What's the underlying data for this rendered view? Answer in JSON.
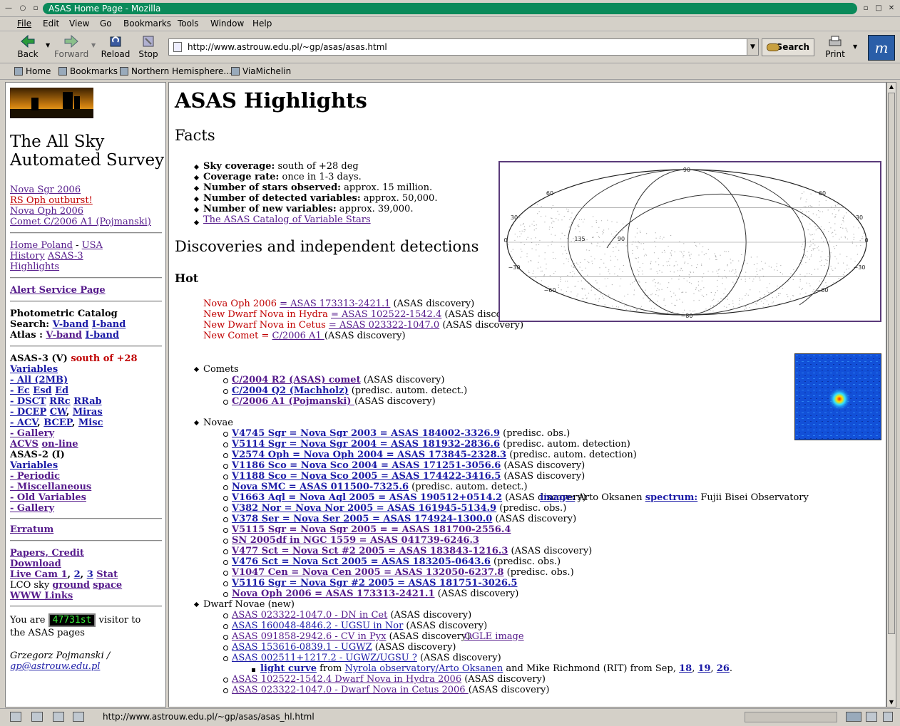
{
  "window": {
    "title": "ASAS Home Page - Mozilla"
  },
  "menu": [
    "File",
    "Edit",
    "View",
    "Go",
    "Bookmarks",
    "Tools",
    "Window",
    "Help"
  ],
  "nav": {
    "back": "Back",
    "forward": "Forward",
    "reload": "Reload",
    "stop": "Stop",
    "search": "Search",
    "print": "Print"
  },
  "url": "http://www.astrouw.edu.pl/~gp/asas/asas.html",
  "personal_bar": [
    "Home",
    "Bookmarks",
    "Northern Hemisphere...",
    "ViaMichelin"
  ],
  "status": "http://www.astrouw.edu.pl/~gp/asas/asas_hl.html",
  "sidebar": {
    "title1": "The All Sky",
    "title2": "Automated Survey",
    "news": [
      "Nova Sgr 2006",
      "RS Oph outburst!",
      "Nova Oph 2006",
      "Comet C/2006 A1 (Pojmanski)"
    ],
    "home_poland": "Home Poland",
    "dash": "-",
    "usa": "USA",
    "history": "History",
    "asas3": "ASAS-3",
    "highlights": "Highlights",
    "alert": "Alert Service Page",
    "photometric": "Photometric Catalog",
    "search_label": "Search:",
    "vband": "V-band",
    "iband": "I-band",
    "atlas_label": "Atlas :",
    "asas3v": "ASAS-3 (V)",
    "south": "south of +28",
    "variables": "Variables",
    "all": "- All (2MB)",
    "ec": "- Ec",
    "esd": "Esd",
    "ed": "Ed",
    "dscT": "- DSCT",
    "rrc": "RRc",
    "rrab": "RRab",
    "dcep": "- DCEP",
    "cw": "CW",
    "miras": "Miras",
    "acv": "- ACV",
    "bcep": "BCEP",
    "misc": "Misc",
    "gallery": "- Gallery",
    "acvs": "ACVS",
    "online": "on-line",
    "asas2": "ASAS-2 (I)",
    "variables2": "Variables",
    "periodic": "- Periodic",
    "miscellaneous": "- Miscellaneous",
    "old_variables": "- Old Variables",
    "gallery2": "- Gallery",
    "erratum": "Erratum",
    "papers": "Papers, Credit",
    "download": "Download",
    "livecam": "Live Cam 1",
    "cam2": "2",
    "cam3": "3",
    "stat": "Stat",
    "lco": "LCO sky",
    "ground": "ground",
    "space": "space",
    "www": "WWW Links",
    "you_are": "You are",
    "counter": "47731st",
    "visitor": "visitor to",
    "asas_pages": "the ASAS pages",
    "author": "Grzegorz Pojmanski /",
    "email": "gp@astrouw.edu.pl"
  },
  "content": {
    "h1": "ASAS Highlights",
    "facts": "Facts",
    "facts_items": [
      {
        "b": "Sky coverage:",
        "t": " south of +28 deg"
      },
      {
        "b": "Coverage rate:",
        "t": " once in 1-3 days."
      },
      {
        "b": "Number of stars observed:",
        "t": " approx. 15 million."
      },
      {
        "b": "Number of detected variables:",
        "t": " approx. 50,000."
      },
      {
        "b": "Number of new variables:",
        "t": " approx. 39,000."
      }
    ],
    "catalog_link": "The ASAS Catalog of Variable Stars",
    "discoveries": "Discoveries and independent detections",
    "hot": "Hot",
    "hot_items": [
      {
        "r": "Nova Oph 2006 ",
        "l": "= ASAS 173313-2421.1",
        "t": " (ASAS discovery)"
      },
      {
        "r": "New Dwarf Nova in Hydra ",
        "l": "= ASAS 102522-1542.4",
        "t": " (ASAS discovery)"
      },
      {
        "r": "New Dwarf Nova in Cetus ",
        "l": "= ASAS 023322-1047.0",
        "t": " (ASAS discovery)"
      },
      {
        "r": "New Comet = ",
        "l": "C/2006 A1 ",
        "t": "(ASAS discovery)"
      }
    ],
    "comets": "Comets",
    "comet_items": [
      {
        "l": "C/2004 R2 (ASAS) comet",
        "t": " (ASAS discovery)"
      },
      {
        "l": "C/2004 Q2 (Machholz)",
        "t": " (predisc. autom. detect.)"
      },
      {
        "l": "C/2006 A1 (Pojmanski) ",
        "t": "(ASAS discovery)"
      }
    ],
    "novae": "Novae",
    "nova_items": [
      {
        "l": "V4745 Sgr = Nova Sgr 2003 = ASAS 184002-3326.9",
        "t": " (predisc. obs.)"
      },
      {
        "l": "V5114 Sgr = Nova Sgr 2004 = ASAS 181932-2836.6",
        "t": " (predisc. autom. detection)"
      },
      {
        "l": "V2574 Oph = Nova Oph 2004 = ASAS 173845-2328.3",
        "t": " (predisc. autom. detection)"
      },
      {
        "l": "V1186 Sco = Nova Sco 2004 = ASAS 171251-3056.6",
        "t": " (ASAS discovery)"
      },
      {
        "l": "V1188 Sco = Nova Sco 2005 = ASAS 174422-3416.5",
        "t": " (ASAS discovery)"
      },
      {
        "l": "Nova SMC = ASAS 011500-7325.6",
        "t": " (predisc. autom. detect.)"
      },
      {
        "l": "V1663 Aql = Nova Aql 2005 = ASAS 190512+0514.2",
        "t": " (ASAS discovery)"
      },
      {
        "l": "V382 Nor = Nova Nor 2005 = ASAS 161945-5134.9",
        "t": " (predisc. obs.)"
      },
      {
        "l": "V378 Ser = Nova Ser 2005 = ASAS 174924-1300.0",
        "t": " (ASAS discovery)"
      },
      {
        "l": "V5115 Sgr = Nova Sgr 2005 = = ASAS 181700-2556.4",
        "t": ""
      },
      {
        "l": "SN 2005df in NGC 1559 = ASAS 041739-6246.3",
        "t": ""
      },
      {
        "l": "V477 Sct = Nova Sct #2 2005 = ASAS 183843-1216.3",
        "t": " (ASAS discovery)"
      },
      {
        "l": "V476 Sct = Nova Sct 2005 = ASAS 183205-0643.6",
        "t": " (predisc. obs.)"
      },
      {
        "l": "V1047 Cen = Nova Cen 2005 = ASAS 132050-6237.8",
        "t": " (predisc. obs.)"
      },
      {
        "l": "V5116 Sgr = Nova Sgr #2 2005 = ASAS 181751-3026.5",
        "t": ""
      },
      {
        "l": "Nova Oph 2006 = ASAS 173313-2421.1",
        "t": " (ASAS discovery)"
      }
    ],
    "aql_image": "image:",
    "aql_oksanen": " Arto Oksanen ",
    "aql_spectrum": "spectrum:",
    "aql_fujii": " Fujii Bisei Observatory",
    "dwarf": "Dwarf Novae (new)",
    "dwarf_items": [
      {
        "l": "ASAS 023322-1047.0 - DN in Cet",
        "t": " (ASAS discovery)"
      },
      {
        "l": "ASAS 160048-4846.2 - UGSU in Nor",
        "t": " (ASAS discovery)"
      },
      {
        "l": "ASAS 091858-2942.6 - CV in Pyx",
        "t": " (ASAS discovery). "
      },
      {
        "l": "ASAS 153616-0839.1 - UGWZ",
        "t": " (ASAS discovery)"
      },
      {
        "l": "ASAS 002511+1217.2 - UGWZ/UGSU ?",
        "t": " (ASAS discovery)"
      },
      {
        "l": "ASAS 102522-1542.4 Dwarf Nova in Hydra 2006",
        "t": " (ASAS discovery)"
      },
      {
        "l": "ASAS 023322-1047.0 - Dwarf Nova in Cetus 2006 ",
        "t": "(ASAS discovery)"
      }
    ],
    "ogle": "OGLE image",
    "lc_light": "light curve",
    "lc_from": " from ",
    "lc_nyrola": "Nyrola observatory/Arto Oksanen",
    "lc_mike": " and Mike Richmond (RIT) from Sep, ",
    "lc_18": "18",
    "lc_19": "19",
    "lc_26": "26",
    "comma": ", ",
    "period": ".",
    "map_labels": [
      "90",
      "60",
      "60",
      "30",
      "30",
      "0",
      "135",
      "90",
      "0",
      "−30",
      "−30",
      "−60",
      "−60",
      "−80"
    ]
  }
}
